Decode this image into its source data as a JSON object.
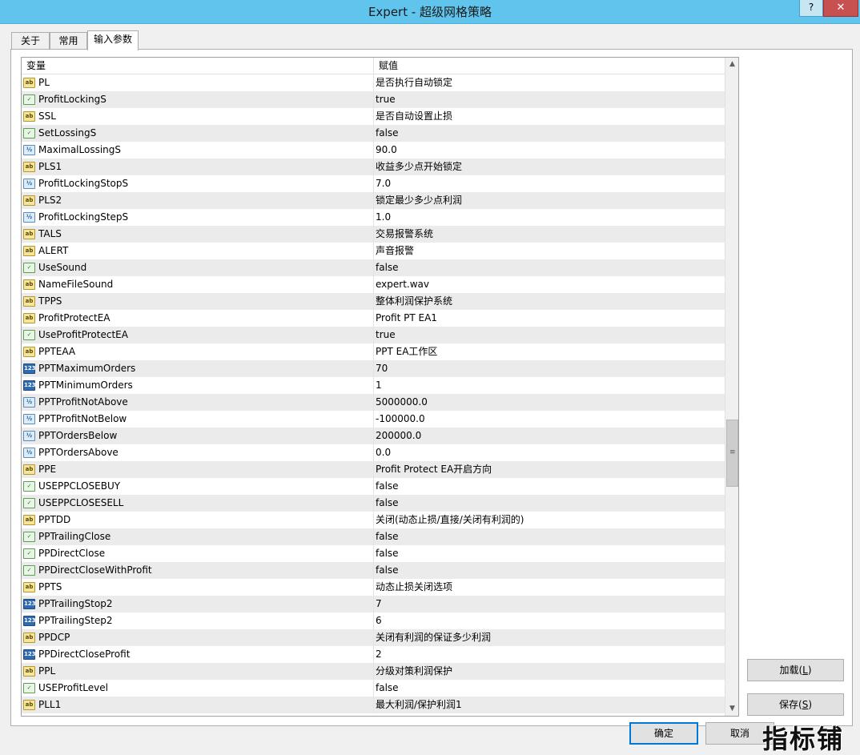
{
  "window": {
    "title": "Expert - 超级网格策略",
    "help_label": "?",
    "close_label": "✕"
  },
  "tabs": [
    {
      "label": "关于"
    },
    {
      "label": "常用"
    },
    {
      "label": "输入参数"
    }
  ],
  "grid": {
    "col_variable": "变量",
    "col_value": "赋值",
    "rows": [
      {
        "type": "ab",
        "name": "PL",
        "value": "是否执行自动锁定"
      },
      {
        "type": "bool",
        "name": "ProfitLockingS",
        "value": "true"
      },
      {
        "type": "ab",
        "name": "SSL",
        "value": "是否自动设置止损"
      },
      {
        "type": "bool",
        "name": "SetLossingS",
        "value": "false"
      },
      {
        "type": "dbl",
        "name": "MaximalLossingS",
        "value": "90.0"
      },
      {
        "type": "ab",
        "name": "PLS1",
        "value": "收益多少点开始锁定"
      },
      {
        "type": "dbl",
        "name": "ProfitLockingStopS",
        "value": "7.0"
      },
      {
        "type": "ab",
        "name": "PLS2",
        "value": "锁定最少多少点利润"
      },
      {
        "type": "dbl",
        "name": "ProfitLockingStepS",
        "value": "1.0"
      },
      {
        "type": "ab",
        "name": "TALS",
        "value": "交易报警系统"
      },
      {
        "type": "ab",
        "name": "ALERT",
        "value": "声音报警"
      },
      {
        "type": "bool",
        "name": "UseSound",
        "value": "false"
      },
      {
        "type": "ab",
        "name": "NameFileSound",
        "value": "expert.wav"
      },
      {
        "type": "ab",
        "name": "TPPS",
        "value": "整体利润保护系统"
      },
      {
        "type": "ab",
        "name": "ProfitProtectEA",
        "value": "Profit PT EA1"
      },
      {
        "type": "bool",
        "name": "UseProfitProtectEA",
        "value": "true"
      },
      {
        "type": "ab",
        "name": "PPTEAA",
        "value": "PPT EA工作区"
      },
      {
        "type": "int",
        "name": "PPTMaximumOrders",
        "value": "70"
      },
      {
        "type": "int",
        "name": "PPTMinimumOrders",
        "value": "1"
      },
      {
        "type": "dbl",
        "name": "PPTProfitNotAbove",
        "value": "5000000.0"
      },
      {
        "type": "dbl",
        "name": "PPTProfitNotBelow",
        "value": "-100000.0"
      },
      {
        "type": "dbl",
        "name": "PPTOrdersBelow",
        "value": "200000.0"
      },
      {
        "type": "dbl",
        "name": "PPTOrdersAbove",
        "value": "0.0"
      },
      {
        "type": "ab",
        "name": "PPE",
        "value": "Profit Protect EA开启方向"
      },
      {
        "type": "bool",
        "name": "USEPPCLOSEBUY",
        "value": "false"
      },
      {
        "type": "bool",
        "name": "USEPPCLOSESELL",
        "value": "false"
      },
      {
        "type": "ab",
        "name": "PPTDD",
        "value": "关闭(动态止损/直接/关闭有利润的)"
      },
      {
        "type": "bool",
        "name": "PPTrailingClose",
        "value": "false"
      },
      {
        "type": "bool",
        "name": "PPDirectClose",
        "value": "false"
      },
      {
        "type": "bool",
        "name": "PPDirectCloseWithProfit",
        "value": "false"
      },
      {
        "type": "ab",
        "name": "PPTS",
        "value": "动态止损关闭选项"
      },
      {
        "type": "int",
        "name": "PPTrailingStop2",
        "value": "7"
      },
      {
        "type": "int",
        "name": "PPTrailingStep2",
        "value": "6"
      },
      {
        "type": "ab",
        "name": "PPDCP",
        "value": "关闭有利润的保证多少利润"
      },
      {
        "type": "int",
        "name": "PPDirectCloseProfit",
        "value": "2"
      },
      {
        "type": "ab",
        "name": "PPL",
        "value": "分级对策利润保护"
      },
      {
        "type": "bool",
        "name": "USEProfitLevel",
        "value": "false"
      },
      {
        "type": "ab",
        "name": "PLL1",
        "value": "最大利润/保护利润1"
      }
    ]
  },
  "icon_glyphs": {
    "ab": "ab",
    "bool": "✓",
    "dbl": "½",
    "int": "123"
  },
  "buttons": {
    "load_label": "加载(",
    "load_key": "L",
    "load_tail": ")",
    "save_label": "保存(",
    "save_key": "S",
    "save_tail": ")",
    "ok_label": "确定",
    "cancel_label": "取消"
  },
  "watermark": "指标铺"
}
